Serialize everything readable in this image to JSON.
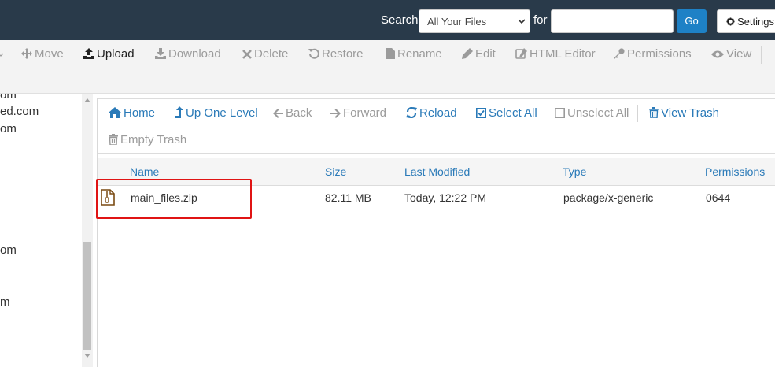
{
  "header": {
    "search_label": "Search",
    "search_scope": "All Your Files",
    "for_label": "for",
    "search_value": "",
    "go_label": "Go",
    "settings_label": "Settings"
  },
  "toolbar": {
    "move": "Move",
    "upload": "Upload",
    "download": "Download",
    "delete": "Delete",
    "restore": "Restore",
    "rename": "Rename",
    "edit": "Edit",
    "html_editor": "HTML Editor",
    "permissions": "Permissions",
    "view": "View"
  },
  "sidebar": {
    "items": [
      "om",
      "ed.com",
      "om",
      "om",
      "m"
    ]
  },
  "nav": {
    "home": "Home",
    "up_one_level": "Up One Level",
    "back": "Back",
    "forward": "Forward",
    "reload": "Reload",
    "select_all": "Select All",
    "unselect_all": "Unselect All",
    "view_trash": "View Trash",
    "empty_trash": "Empty Trash"
  },
  "table": {
    "columns": [
      "Name",
      "Size",
      "Last Modified",
      "Type",
      "Permissions"
    ],
    "rows": [
      {
        "name": "main_files.zip",
        "size": "82.11 MB",
        "last_modified": "Today, 12:22 PM",
        "type": "package/x-generic",
        "permissions": "0644",
        "icon": "zip-file-icon"
      }
    ]
  },
  "colors": {
    "topbar": "#293a4a",
    "accent": "#2a7ab8",
    "go_button": "#1e81c6",
    "highlight": "#e01414",
    "disabled": "#9b9b9b"
  }
}
